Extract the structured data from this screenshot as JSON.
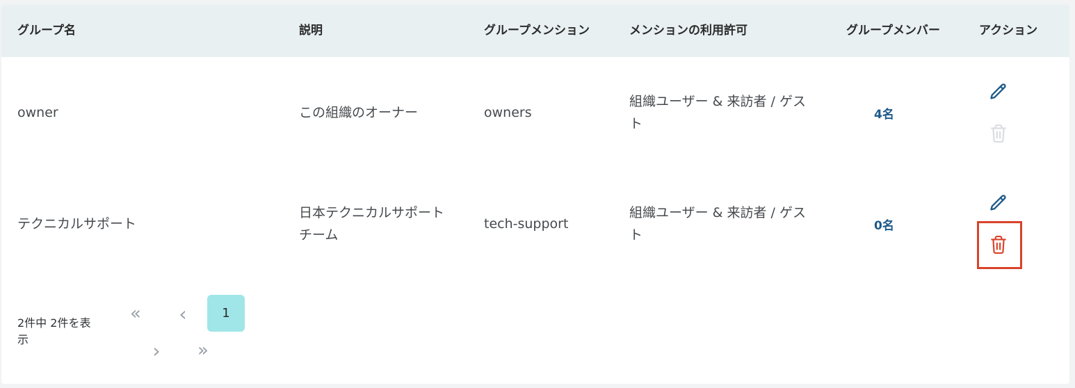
{
  "table": {
    "columns": {
      "group_name": "グループ名",
      "description": "説明",
      "group_mention": "グループメンション",
      "mention_permission": "メンションの利用許可",
      "group_members": "グループメンバー",
      "actions": "アクション"
    },
    "rows": [
      {
        "group_name": "owner",
        "description": "この組織のオーナー",
        "group_mention": "owners",
        "mention_permission": "組織ユーザー & 来訪者 / ゲスト",
        "members": "4名",
        "delete_enabled": false
      },
      {
        "group_name": "テクニカルサポート",
        "description": "日本テクニカルサポートチーム",
        "group_mention": "tech-support",
        "mention_permission": "組織ユーザー & 来訪者 / ゲスト",
        "members": "0名",
        "delete_enabled": true
      }
    ]
  },
  "pagination": {
    "summary": "2件中 2件を表示",
    "first": "«",
    "prev": "‹",
    "current_page": "1",
    "next": "›",
    "last": "»"
  },
  "colors": {
    "header_bg": "#e8f0f2",
    "link": "#1e5a8a",
    "edit_icon": "#1e5a8a",
    "delete_icon_active": "#d9432a",
    "delete_icon_disabled": "#dadce0",
    "highlight": "#d9432a",
    "current_page_bg": "#a0e6e8"
  },
  "icons": {
    "edit": "pencil-icon",
    "delete": "trash-icon",
    "first": "double-chevron-left-icon",
    "prev": "chevron-left-icon",
    "next": "chevron-right-icon",
    "last": "double-chevron-right-icon"
  }
}
